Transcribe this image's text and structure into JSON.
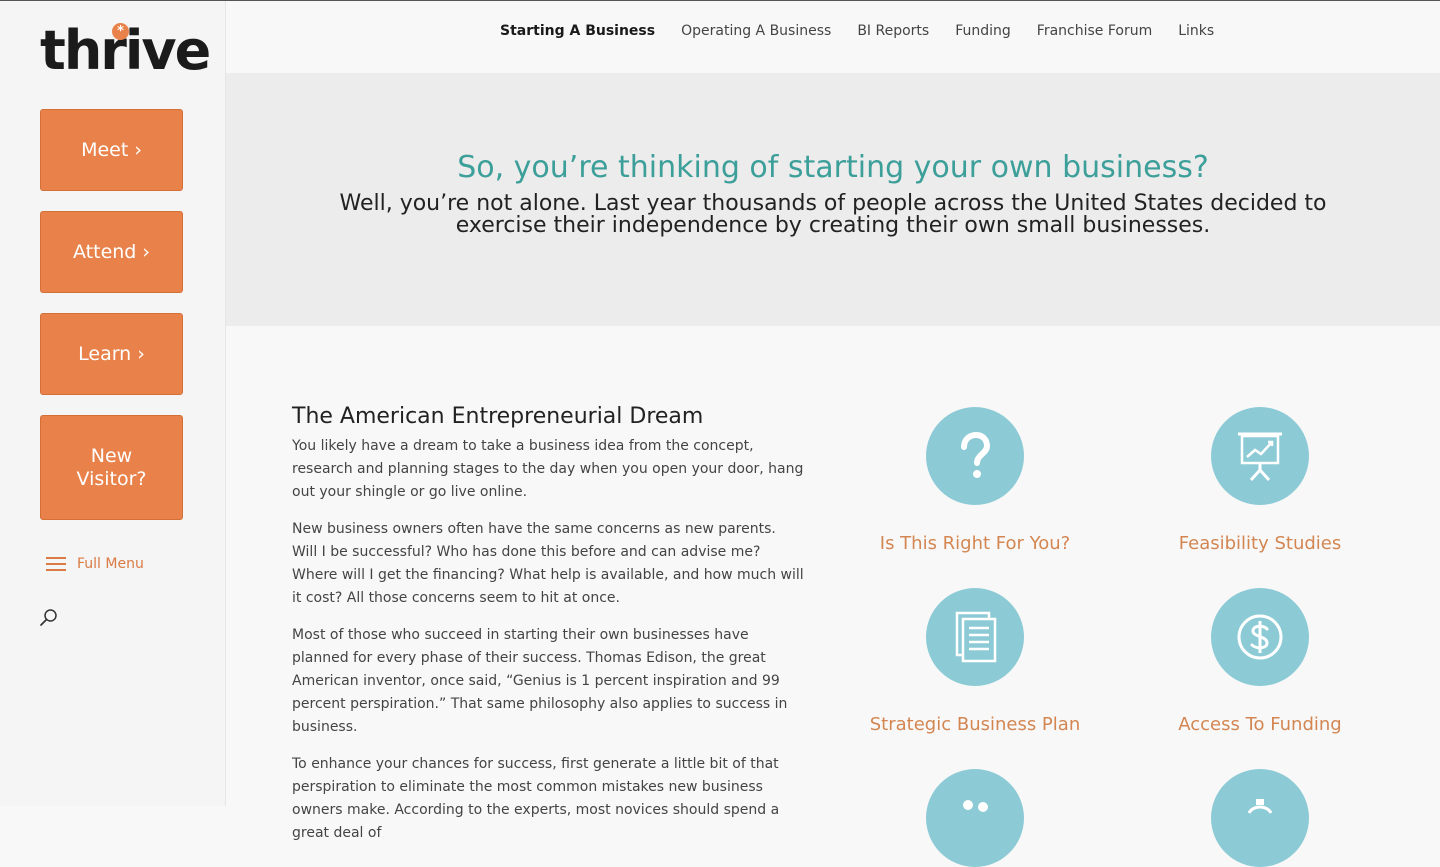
{
  "sidebar": {
    "logo_text": "thrive",
    "logo_star": "*",
    "buttons": [
      {
        "label": "Meet ›"
      },
      {
        "label": "Attend ›"
      },
      {
        "label": "Learn ›"
      },
      {
        "label": "New\nVisitor?"
      }
    ],
    "full_menu_label": "Full Menu",
    "search_icon": "search-icon",
    "menu_icon": "hamburger-icon"
  },
  "nav": {
    "items": [
      {
        "label": "Starting A Business",
        "active": true
      },
      {
        "label": "Operating A Business"
      },
      {
        "label": "BI Reports"
      },
      {
        "label": "Funding"
      },
      {
        "label": "Franchise Forum"
      },
      {
        "label": "Links"
      }
    ]
  },
  "hero": {
    "title": "So, you’re thinking of starting your own business?",
    "subtitle": "Well, you’re not alone. Last year thousands of people across the United States decided to exercise their independence by creating their own small businesses."
  },
  "article": {
    "heading": "The American Entrepreneurial Dream",
    "paragraphs": [
      "You likely have a dream to take a business idea from the concept, research and planning stages to the day when you open your door, hang out your shingle or go live online.",
      "New business owners often have the same concerns as new parents. Will I be successful? Who has done this before and can advise me? Where will I get the financing? What help is available, and how much will it cost? All those concerns seem to hit at once.",
      "Most of those who succeed in starting their own businesses have planned for every phase of their success. Thomas Edison, the great American inventor, once said, “Genius is 1 percent inspiration and 99 percent perspiration.” That same philosophy also applies to success in business.",
      "To enhance your chances for success, first generate a little bit of that perspiration to eliminate the most common mistakes new business owners make. According to the experts, most novices should spend a great deal of"
    ]
  },
  "features": [
    {
      "label": "Is This Right For You?",
      "icon": "question-mark-icon"
    },
    {
      "label": "Feasibility Studies",
      "icon": "presentation-chart-icon"
    },
    {
      "label": "Strategic Business Plan",
      "icon": "document-icon"
    },
    {
      "label": "Access To Funding",
      "icon": "dollar-icon"
    },
    {
      "label": "",
      "icon": "people-icon"
    },
    {
      "label": "",
      "icon": "clock-icon"
    }
  ],
  "colors": {
    "accent_orange": "#e8824a",
    "teal_heading": "#3d9f9a",
    "icon_circle": "#8ccbd6",
    "feature_label": "#d38651"
  }
}
